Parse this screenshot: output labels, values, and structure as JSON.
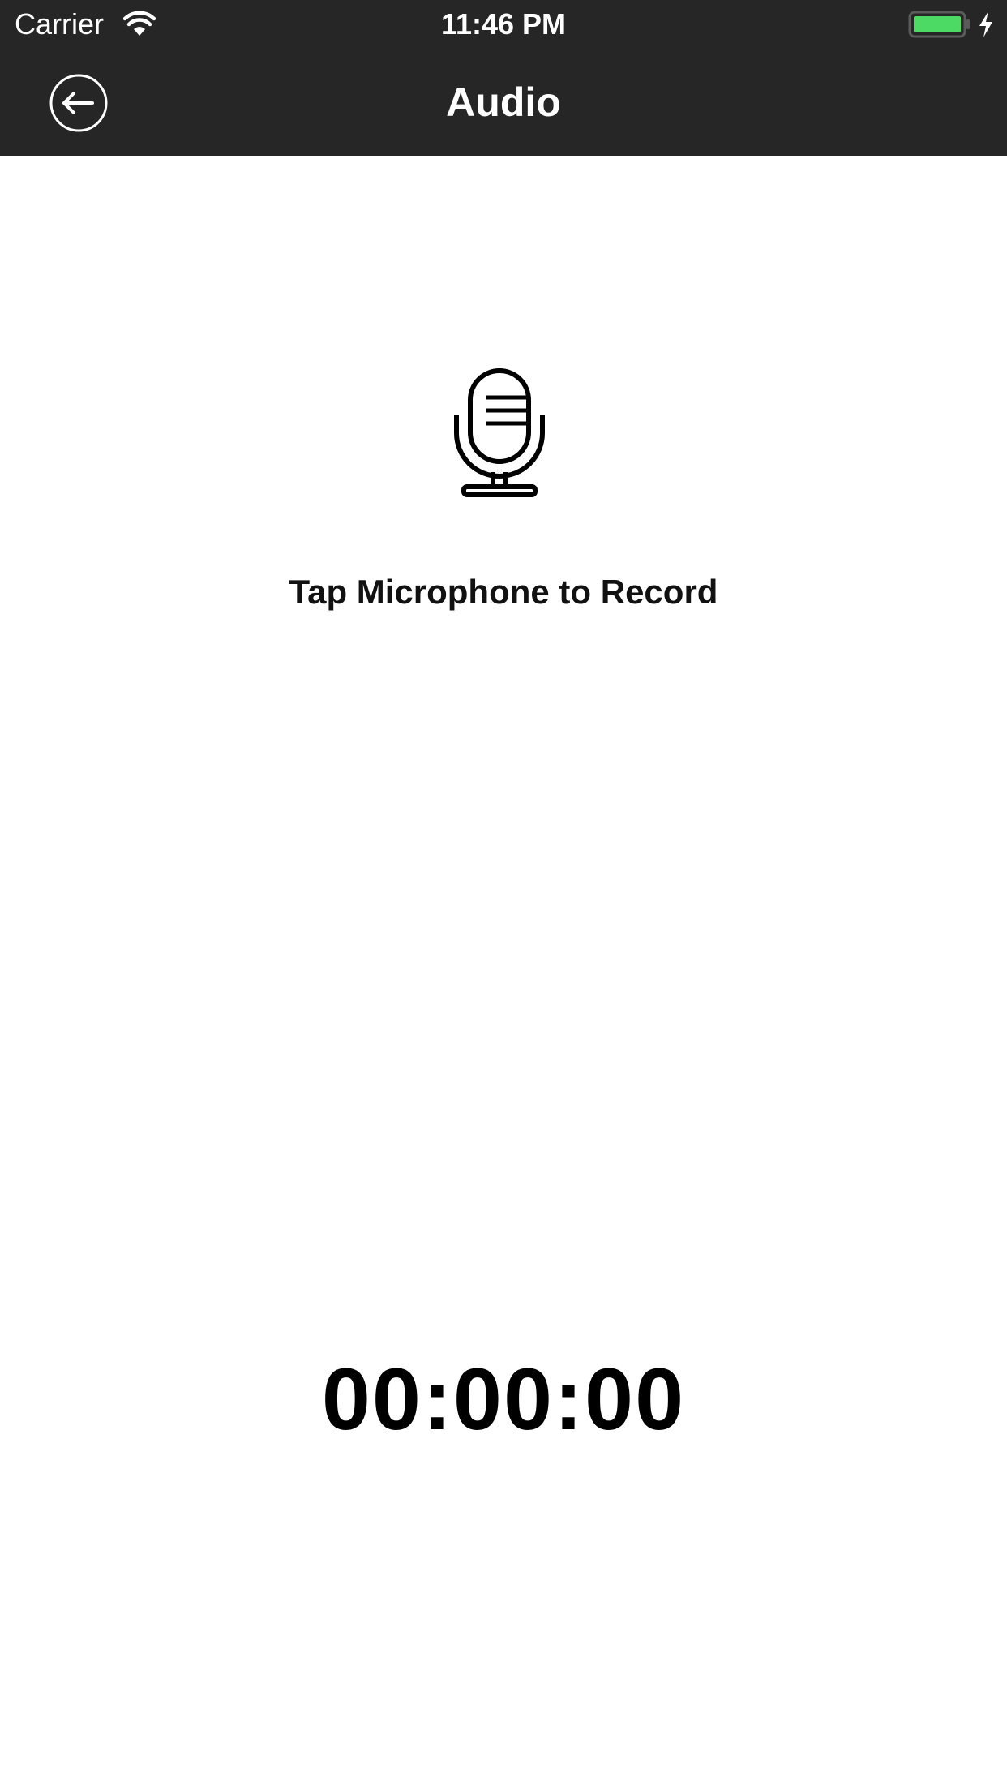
{
  "status_bar": {
    "carrier": "Carrier",
    "time": "11:46 PM",
    "battery_color": "#4cd964",
    "icons": [
      "wifi-icon",
      "battery-icon",
      "charging-bolt-icon"
    ]
  },
  "nav": {
    "title": "Audio",
    "back_icon": "back-arrow-circle-icon",
    "background_color": "#262626"
  },
  "recorder": {
    "mic_icon": "microphone-icon",
    "prompt": "Tap Microphone to Record",
    "elapsed_time": "00:00:00"
  }
}
